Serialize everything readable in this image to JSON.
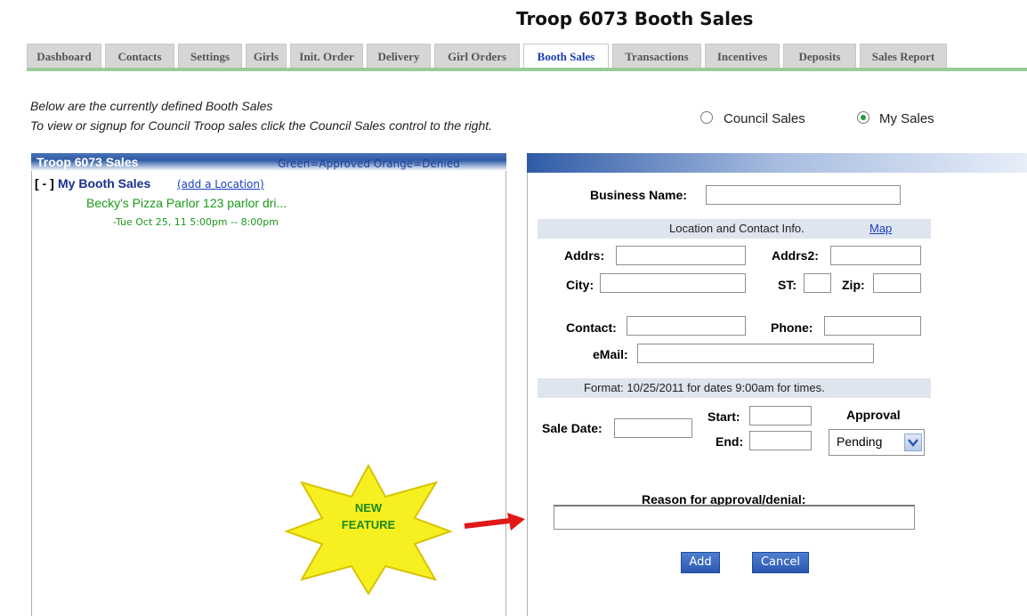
{
  "page_title": "Troop 6073 Booth Sales",
  "tabs": [
    {
      "label": "Dashboard",
      "active": false
    },
    {
      "label": "Contacts",
      "active": false
    },
    {
      "label": "Settings",
      "active": false
    },
    {
      "label": "Girls",
      "active": false
    },
    {
      "label": "Init. Order",
      "active": false
    },
    {
      "label": "Delivery",
      "active": false
    },
    {
      "label": "Girl Orders",
      "active": false
    },
    {
      "label": "Booth Sales",
      "active": true
    },
    {
      "label": "Transactions",
      "active": false
    },
    {
      "label": "Incentives",
      "active": false
    },
    {
      "label": "Deposits",
      "active": false
    },
    {
      "label": "Sales Report",
      "active": false
    }
  ],
  "intro": {
    "line1": "Below are the currently defined Booth Sales",
    "line2": "To view or signup for Council Troop sales click the Council Sales control to the right."
  },
  "sales_filter": {
    "options": [
      {
        "label": "Council Sales",
        "selected": false
      },
      {
        "label": "My Sales",
        "selected": true
      }
    ]
  },
  "left_panel": {
    "title": "Troop 6073 Sales",
    "legend": "Green=Approved   Orange=Denied",
    "tree_toggle": "[ - ]",
    "tree_title": "My Booth Sales",
    "add_location": "(add a Location)",
    "sale_location": "Becky's Pizza Parlor 123 parlor dri...",
    "sale_time": "-Tue Oct 25, 11    5:00pm -- 8:00pm"
  },
  "form": {
    "business_name_label": "Business Name:",
    "business_name_value": "",
    "location_section": "Location and Contact Info.",
    "map_link": "Map",
    "addrs_label": "Addrs:",
    "addrs2_label": "Addrs2:",
    "city_label": "City:",
    "st_label": "ST:",
    "zip_label": "Zip:",
    "contact_label": "Contact:",
    "phone_label": "Phone:",
    "email_label": "eMail:",
    "format_note": "Format: 10/25/2011 for dates    9:00am for times.",
    "sale_date_label": "Sale Date:",
    "start_label": "Start:",
    "end_label": "End:",
    "approval_label": "Approval",
    "approval_value": "Pending",
    "reason_label": "Reason for approval/denial:",
    "add_button": "Add",
    "cancel_button": "Cancel"
  },
  "callout": {
    "line1": "NEW",
    "line2": "FEATURE",
    "star_color": "#f7f020",
    "arrow_color": "#e01818"
  }
}
